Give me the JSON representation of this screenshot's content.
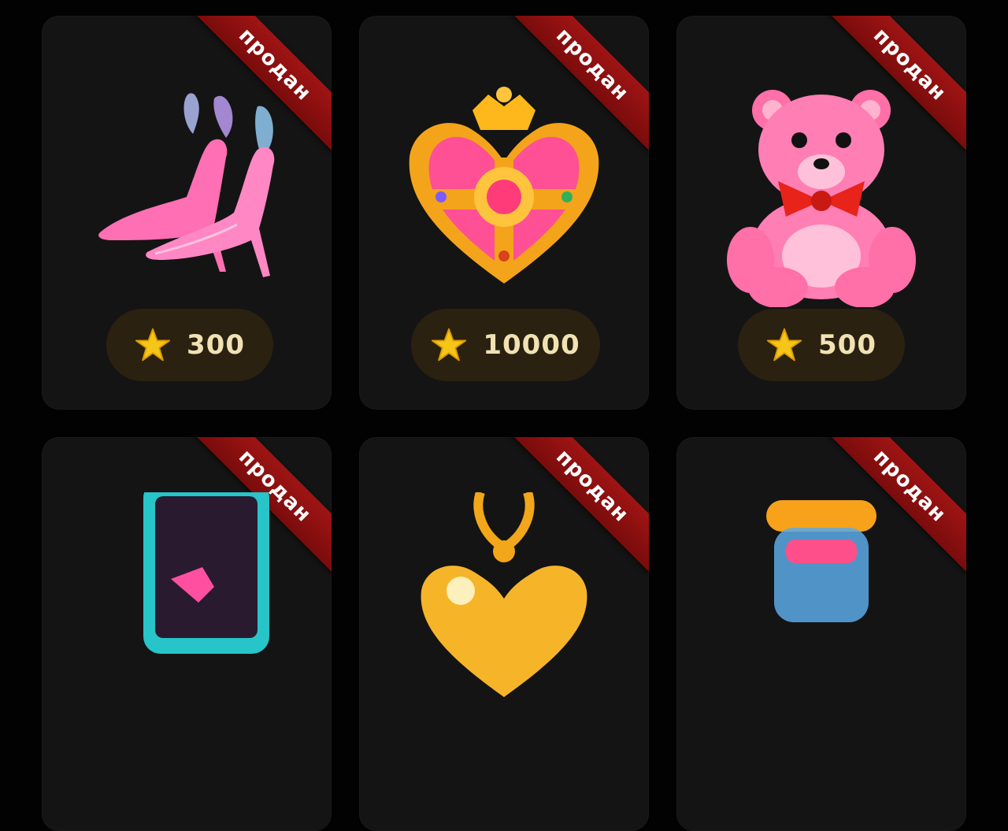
{
  "gifts": [
    {
      "status": "продан",
      "price": "300",
      "icon": "shoes-icon"
    },
    {
      "status": "продан",
      "price": "10000",
      "icon": "heart-locket-icon"
    },
    {
      "status": "продан",
      "price": "500",
      "icon": "teddy-bear-icon"
    },
    {
      "status": "продан",
      "price": "",
      "icon": "phone-icon"
    },
    {
      "status": "продан",
      "price": "",
      "icon": "heart-pendant-icon"
    },
    {
      "status": "продан",
      "price": "",
      "icon": "jar-icon"
    }
  ],
  "colors": {
    "ribbon": "#8b0f0f",
    "price_bg": "#2b2110",
    "star": "#f5c518",
    "card_bg": "#141414"
  }
}
